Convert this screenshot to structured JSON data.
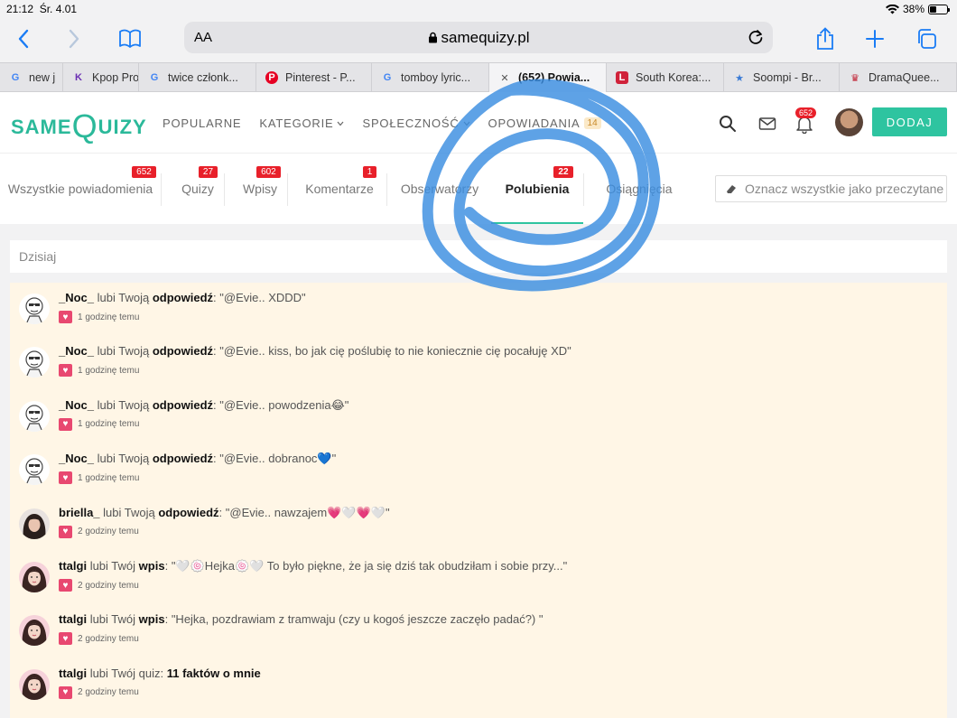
{
  "status": {
    "time": "21:12",
    "date": "Śr. 4.01",
    "battery": "38%"
  },
  "browser": {
    "aa": "AA",
    "url": "samequizy.pl",
    "tabs": [
      {
        "title": "new j",
        "icon": "google-icon",
        "fav": "G",
        "favColor": "#4285f4"
      },
      {
        "title": "Kpop Pro",
        "icon": "k-icon",
        "fav": "K",
        "favColor": "#6b2fb3"
      },
      {
        "title": "twice członk...",
        "icon": "google-icon",
        "fav": "G",
        "favColor": "#4285f4"
      },
      {
        "title": "Pinterest - P...",
        "icon": "pinterest-icon",
        "fav": "P",
        "favColor": "#e60023"
      },
      {
        "title": "tomboy lyric...",
        "icon": "google-icon",
        "fav": "G",
        "favColor": "#4285f4"
      },
      {
        "title": "(652) Powia...",
        "icon": "close-tab-icon",
        "fav": "✕",
        "favColor": "#555"
      },
      {
        "title": "South Korea:...",
        "icon": "l-icon",
        "fav": "L",
        "favColor": "#d0223a"
      },
      {
        "title": "Soompi - Br...",
        "icon": "star-icon",
        "fav": "★",
        "favColor": "#3a7bd5"
      },
      {
        "title": "DramaQuee...",
        "icon": "crown-icon",
        "fav": "♛",
        "favColor": "#c01d2f"
      }
    ]
  },
  "site": {
    "logo": {
      "same": "SAME",
      "q": "Q",
      "uizy": "UIZY"
    },
    "nav": [
      {
        "label": "POPULARNE"
      },
      {
        "label": "KATEGORIE",
        "dropdown": true
      },
      {
        "label": "SPOŁECZNOŚĆ",
        "dropdown": true
      },
      {
        "label": "OPOWIADANIA",
        "count": "14"
      }
    ],
    "bell_count": "652",
    "add_label": "DODAJ"
  },
  "ntabs": [
    {
      "label": "Wszystkie powiadomienia",
      "badge": "652"
    },
    {
      "label": "Quizy",
      "badge": "27"
    },
    {
      "label": "Wpisy",
      "badge": "602"
    },
    {
      "label": "Komentarze",
      "badge": "1"
    },
    {
      "label": "Obserwatorzy",
      "badge": ""
    },
    {
      "label": "Polubienia",
      "badge": "22",
      "active": true
    },
    {
      "label": "Osiągnięcia",
      "badge": ""
    }
  ],
  "mark_all": "Oznacz wszystkie jako przeczytane",
  "day": "Dzisiaj",
  "notifications": [
    {
      "user": "_Noc_",
      "verb": "lubi Twoją",
      "type": "odpowiedź",
      "sep": ":",
      "text": "\"@Evie.. XDDD\"",
      "time": "1 godzinę temu",
      "avatar": "meme"
    },
    {
      "user": "_Noc_",
      "verb": "lubi Twoją",
      "type": "odpowiedź",
      "sep": ":",
      "text": "\"@Evie.. kiss, bo jak cię poślubię to nie koniecznie cię pocałuję XD\"",
      "time": "1 godzinę temu",
      "avatar": "meme"
    },
    {
      "user": "_Noc_",
      "verb": "lubi Twoją",
      "type": "odpowiedź",
      "sep": ":",
      "text": "\"@Evie.. powodzenia😂\"",
      "time": "1 godzinę temu",
      "avatar": "meme"
    },
    {
      "user": "_Noc_",
      "verb": "lubi Twoją",
      "type": "odpowiedź",
      "sep": ":",
      "text": "\"@Evie.. dobranoc💙\"",
      "time": "1 godzinę temu",
      "avatar": "meme"
    },
    {
      "user": "briella_",
      "verb": "lubi Twoją",
      "type": "odpowiedź",
      "sep": ":",
      "text": "\"@Evie.. nawzajem💗🤍💗🤍\"",
      "time": "2 godziny temu",
      "avatar": "dark"
    },
    {
      "user": "ttalgi",
      "verb": "lubi Twój",
      "type": "wpis",
      "sep": ":",
      "text": "\"🤍🍥Hejka🍥🤍 To było piękne, że ja się dziś tak obudziłam i sobie przy...\"",
      "time": "2 godziny temu",
      "avatar": "pink"
    },
    {
      "user": "ttalgi",
      "verb": "lubi Twój",
      "type": "wpis",
      "sep": ":",
      "text": "\"Hejka, pozdrawiam z tramwaju (czy u kogoś jeszcze zaczęło padać?) \"",
      "time": "2 godziny temu",
      "avatar": "pink"
    },
    {
      "user": "ttalgi",
      "verb": "lubi Twój quiz:",
      "type": "11 faktów o mnie",
      "sep": "",
      "text": "",
      "time": "2 godziny temu",
      "avatar": "pink"
    }
  ]
}
